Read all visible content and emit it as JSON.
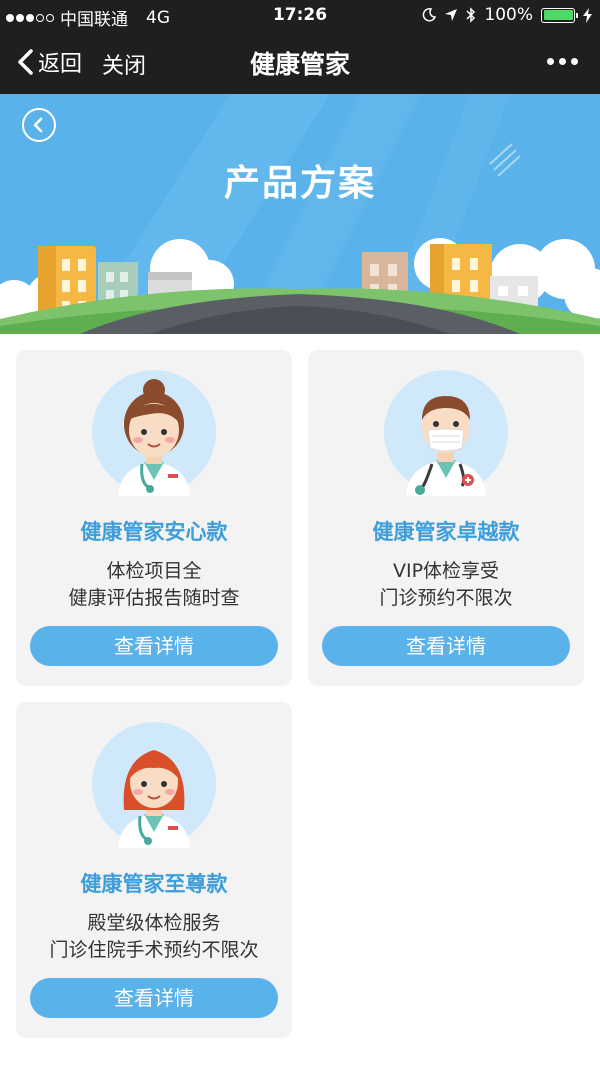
{
  "status_bar": {
    "carrier": "中国联通",
    "network": "4G",
    "time": "17:26",
    "battery": "100%"
  },
  "nav": {
    "back_label": "返回",
    "close_label": "关闭",
    "title": "健康管家"
  },
  "banner": {
    "title": "产品方案"
  },
  "plans": [
    {
      "name": "健康管家安心款",
      "desc_line1": "体检项目全",
      "desc_line2": "健康评估报告随时查",
      "button": "查看详情"
    },
    {
      "name": "健康管家卓越款",
      "desc_line1": "VIP体检享受",
      "desc_line2": "门诊预约不限次",
      "button": "查看详情"
    },
    {
      "name": "健康管家至尊款",
      "desc_line1": "殿堂级体检服务",
      "desc_line2": "门诊住院手术预约不限次",
      "button": "查看详情"
    }
  ],
  "colors": {
    "accent": "#5ab2ea",
    "plan_name": "#3e9ed9",
    "card_bg": "#f3f3f3",
    "nav_bg": "#1f1f1f"
  }
}
